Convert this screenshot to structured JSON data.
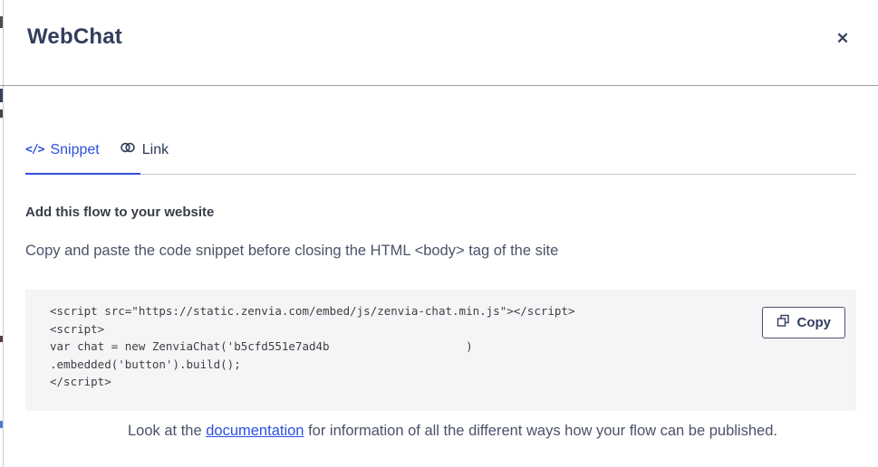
{
  "modal": {
    "title": "WebChat",
    "close_icon": "✕"
  },
  "tabs": {
    "snippet": {
      "label": "Snippet",
      "icon": "</>"
    },
    "link": {
      "label": "Link"
    }
  },
  "content": {
    "heading": "Add this flow to your website",
    "instruction": "Copy and paste the code snippet before closing the HTML <body> tag of the site",
    "code": {
      "lines": [
        "<script src=\"https://static.zenvia.com/embed/js/zenvia-chat.min.js\"></script>",
        "<script>",
        "var chat = new ZenviaChat('b5cfd551e7ad4b                    )",
        ".embedded('button').build();",
        "</script>"
      ],
      "copy_label": "Copy"
    },
    "footer": {
      "prefix": "Look at the ",
      "link_text": "documentation",
      "suffix": " for information of all the different ways how your flow can be published."
    }
  },
  "colors": {
    "accent_blue": "#2d4fdd",
    "title_navy": "#333d5c",
    "body_text": "#4b5269",
    "code_background": "#f5f5f7"
  }
}
